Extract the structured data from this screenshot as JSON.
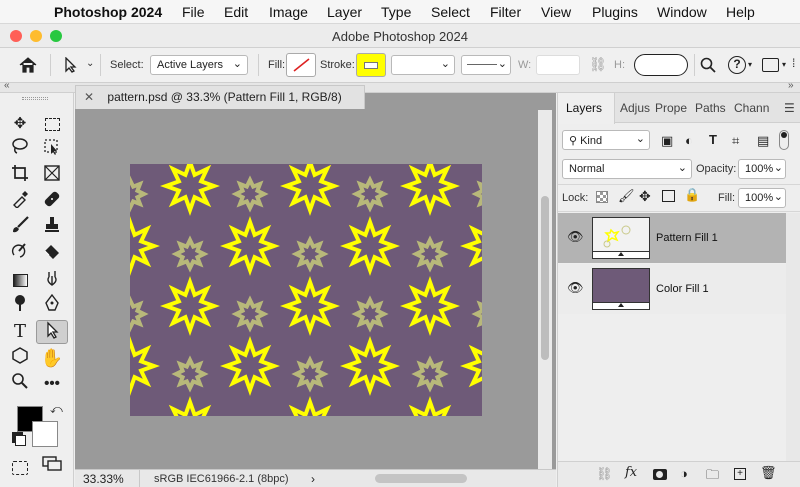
{
  "menu": {
    "items": [
      "Photoshop 2024",
      "File",
      "Edit",
      "Image",
      "Layer",
      "Type",
      "Select",
      "Filter",
      "View",
      "Plugins",
      "Window",
      "Help"
    ]
  },
  "window": {
    "title": "Adobe Photoshop 2024"
  },
  "options": {
    "select_label": "Select:",
    "select_value": "Active Layers",
    "fill_label": "Fill:",
    "stroke_label": "Stroke:",
    "w_label": "W:",
    "h_label": "H:"
  },
  "document": {
    "tab_title": "pattern.psd @ 33.3% (Pattern Fill 1, RGB/8)",
    "zoom": "33.33%",
    "color_profile": "sRGB IEC61966-2.1 (8bpc)"
  },
  "panel": {
    "tabs": [
      "Layers",
      "Adjus",
      "Prope",
      "Paths",
      "Chann"
    ],
    "filter_label": "Kind",
    "blend_mode": "Normal",
    "opacity_label": "Opacity:",
    "opacity": "100%",
    "lock_label": "Lock:",
    "fill_label": "Fill:",
    "fill": "100%",
    "layers": [
      {
        "name": "Pattern Fill 1",
        "selected": true
      },
      {
        "name": "Color Fill 1",
        "selected": false
      }
    ]
  },
  "colors": {
    "canvas": "#6e5a78",
    "star_yellow": "#ffff00",
    "star_olive": "#b8b87a",
    "foreground": "#000000",
    "background": "#ffffff",
    "stroke_swatch": "#ffff00"
  }
}
